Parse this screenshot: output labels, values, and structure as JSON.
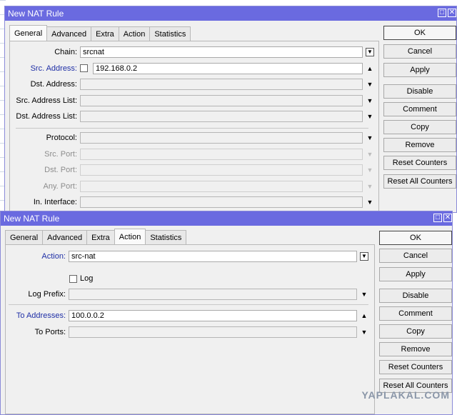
{
  "window1": {
    "title": "New NAT Rule",
    "tabs": [
      "General",
      "Advanced",
      "Extra",
      "Action",
      "Statistics"
    ],
    "active_tab": "General",
    "fields": {
      "chain": {
        "label": "Chain:",
        "value": "srcnat"
      },
      "src_address": {
        "label": "Src. Address:",
        "value": "192.168.0.2"
      },
      "dst_address": {
        "label": "Dst. Address:"
      },
      "src_address_list": {
        "label": "Src. Address List:"
      },
      "dst_address_list": {
        "label": "Dst. Address List:"
      },
      "protocol": {
        "label": "Protocol:"
      },
      "src_port": {
        "label": "Src. Port:"
      },
      "dst_port": {
        "label": "Dst. Port:"
      },
      "any_port": {
        "label": "Any. Port:"
      },
      "in_interface": {
        "label": "In. Interface:"
      }
    },
    "buttons": [
      "OK",
      "Cancel",
      "Apply",
      "Disable",
      "Comment",
      "Copy",
      "Remove",
      "Reset Counters",
      "Reset All Counters"
    ]
  },
  "window2": {
    "title": "New NAT Rule",
    "tabs": [
      "General",
      "Advanced",
      "Extra",
      "Action",
      "Statistics"
    ],
    "active_tab": "Action",
    "fields": {
      "action": {
        "label": "Action:",
        "value": "src-nat"
      },
      "log": {
        "label": "Log",
        "checked": false
      },
      "log_prefix": {
        "label": "Log Prefix:"
      },
      "to_addresses": {
        "label": "To Addresses:",
        "value": "100.0.0.2"
      },
      "to_ports": {
        "label": "To Ports:"
      }
    },
    "buttons": [
      "OK",
      "Cancel",
      "Apply",
      "Disable",
      "Comment",
      "Copy",
      "Remove",
      "Reset Counters",
      "Reset All Counters"
    ]
  },
  "watermark": "YAPLAKAL.COM",
  "colors": {
    "titlebar": "#6a6ae0",
    "label_blue": "#1f2fa6"
  }
}
